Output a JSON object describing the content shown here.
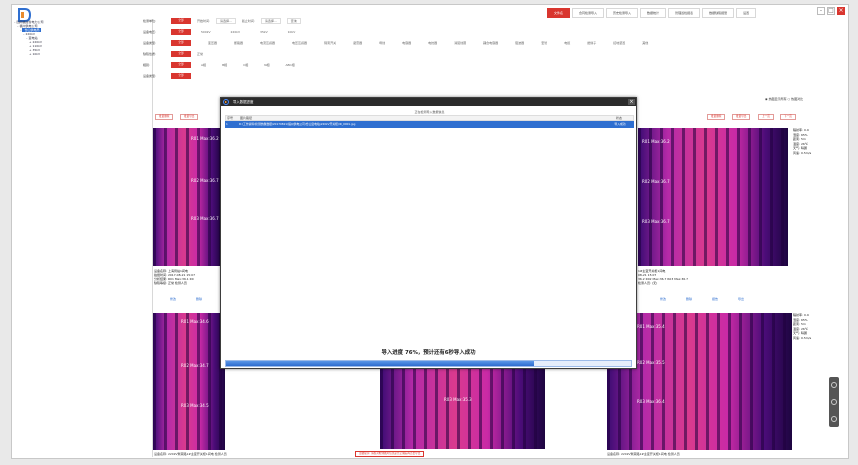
{
  "app": {
    "topbar": [
      "文件名",
      "合同检测导入",
      "历史检测导入",
      "数据统计",
      "管理巡检报表",
      "数据缺陷报警",
      "设置"
    ],
    "win_controls": [
      "-",
      "□",
      "×"
    ]
  },
  "tree": {
    "items": [
      "国网福建省电力公司",
      "福州供电公司",
      "仓山供电局",
      "220kV",
      "变电站",
      "220kV",
      "110kV",
      "35kV",
      "10kV"
    ],
    "selected_index": 2
  },
  "filters": {
    "rows": [
      {
        "label": "检测单位:",
        "badge": "全部",
        "options": [
          "开始时间:",
          "请选择...",
          "截止时间:",
          "请选择...",
          "查询"
        ]
      },
      {
        "label": "设备电压:",
        "badge": "全部",
        "options": [
          "500kV",
          "220kV",
          "35kV",
          "10kV"
        ]
      },
      {
        "label": "设备类型:",
        "badge": "全部",
        "options": [
          "变压器",
          "断路器",
          "电流互感器",
          "电压互感器",
          "隔离开关",
          "避雷器",
          "母线",
          "电容器",
          "电抗器",
          "消弧线圈",
          "耦合电容器",
          "阻波器",
          "套管",
          "电缆",
          "绝缘子",
          "接地装置",
          "其他"
        ]
      },
      {
        "label": "缺陷性质:",
        "badge": "全部",
        "options": [
          "正常"
        ]
      },
      {
        "label": "相别:",
        "badge": "全部",
        "options": [
          "A相",
          "B相",
          "C相",
          "N相",
          "ABC相"
        ]
      },
      {
        "label": "设备类型:",
        "badge": "全部",
        "options": []
      }
    ]
  },
  "rowbar": {
    "left_buttons": [
      "批量删除",
      "批量导出"
    ],
    "right_buttons": [
      "批量删除",
      "批量导出",
      "上一页",
      "下一页"
    ]
  },
  "radio": {
    "label1": "热图显示所有",
    "label2": "热图对比"
  },
  "panels": [
    {
      "readings": [
        "R01 Max:36.2",
        "R02 Max:36.7",
        "R03 Max:36.7"
      ]
    },
    {
      "readings": [
        "R01 Max:36.2",
        "R02 Max:36.7",
        "R03 Max:36.7"
      ]
    },
    {
      "readings": [
        "R01 Max:34.6",
        "R02 Max:34.7",
        "R03 Max:34.5"
      ]
    },
    {
      "readings": [
        "R01 Max:35.4",
        "R02 Max:35.5",
        "R03 Max:35.3"
      ]
    },
    {
      "readings": [
        "R01 Max:35.4",
        "R02 Max:35.5",
        "R03 Max:36.4"
      ]
    }
  ],
  "info": {
    "left": [
      "设备名称: 上海局站1间电",
      "拍摄时间: 2017-08-21 15:07",
      "分析结果: R01 Max:36.1 R0",
      "缺陷等级: 正常 检测人员"
    ],
    "right": [
      "1#主变开关柜1间电",
      "08-21 15:07",
      "36.2 R02 Max:36.7 R03 Max:36.7",
      "检测人员: (无)"
    ]
  },
  "params": [
    "辐射率: 0.9",
    "湿度: 65%",
    "距离: 5m",
    "温度: 26℃",
    "天气: 晴朗",
    "风速: 0.5m/s"
  ],
  "subbar": [
    "修改",
    "删除",
    "报告",
    "导出"
  ],
  "modal": {
    "title": "导入数据进度",
    "caption": "正在检测导入数据信息",
    "col_index": "序号",
    "col_path": "图片路径",
    "col_status": "状态",
    "row_index": "1",
    "row_path": "D:\\工作资料\\检测热像数据\\20170821\\福州供电公司\\仓山变电站\\220kV开关柜\\IR_0001.jpg",
    "row_status": "导入成功",
    "progress_text": "导入进度 76%，预计还有6秒导入成功",
    "progress": 0.76
  },
  "bottom_msg": "温馨提示: 请核对检测图片信息是否正确后再点击导出",
  "captions": [
    "设备名称: 220kV繁荣路1#主变开关柜1间电 检测人员",
    "设备名称: 220kV繁荣路1#主变开关柜1间电 检测人员"
  ]
}
